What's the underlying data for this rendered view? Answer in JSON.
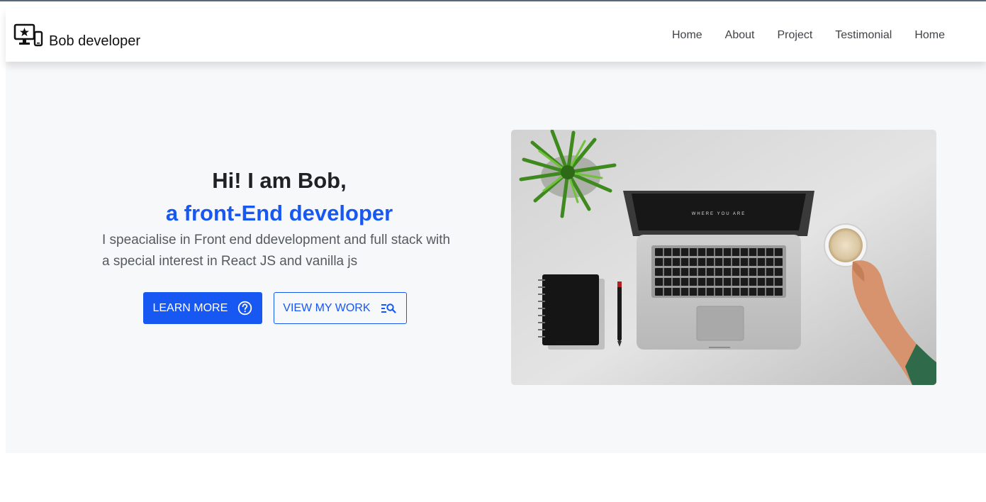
{
  "brand": {
    "name": "Bob developer",
    "icon": "devices-star-icon"
  },
  "nav": {
    "items": [
      "Home",
      "About",
      "Project",
      "Testimonial",
      "Home"
    ]
  },
  "hero": {
    "greeting": "Hi! I am Bob,",
    "role": "a front-End developer",
    "description": "I speacialise in Front end ddevelopment and full stack with a special interest in React JS and vanilla js",
    "primary_button": {
      "label": "LEARN MORE",
      "icon": "question-circle-icon"
    },
    "secondary_button": {
      "label": "VIEW MY WORK",
      "icon": "list-search-icon"
    },
    "image": {
      "alt": "Desk with laptop, plant, notebook, pen and coffee cup",
      "laptop_screen_text": "WHERE YOU ARE"
    }
  },
  "colors": {
    "accent": "#1757f2",
    "hero_background": "#f7f8fa",
    "heading": "#202124",
    "body_text": "#555a5f"
  }
}
